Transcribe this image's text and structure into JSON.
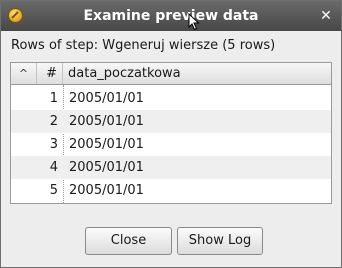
{
  "window": {
    "title": "Examine preview data",
    "close_glyph": "✕",
    "app_icon": "kettle-app-icon"
  },
  "preview": {
    "rows_label": "Rows of step: Wgeneruj wiersze (5 rows)"
  },
  "table": {
    "sort_glyph": "^",
    "columns": [
      "#",
      "data_poczatkowa"
    ],
    "rows": [
      {
        "num": "1",
        "value": "2005/01/01"
      },
      {
        "num": "2",
        "value": "2005/01/01"
      },
      {
        "num": "3",
        "value": "2005/01/01"
      },
      {
        "num": "4",
        "value": "2005/01/01"
      },
      {
        "num": "5",
        "value": "2005/01/01"
      }
    ]
  },
  "buttons": {
    "close_label": "Close",
    "show_log_label": "Show Log"
  },
  "colors": {
    "titlebar": "#555555",
    "window_bg": "#ededed",
    "alt_row": "#efefef"
  }
}
